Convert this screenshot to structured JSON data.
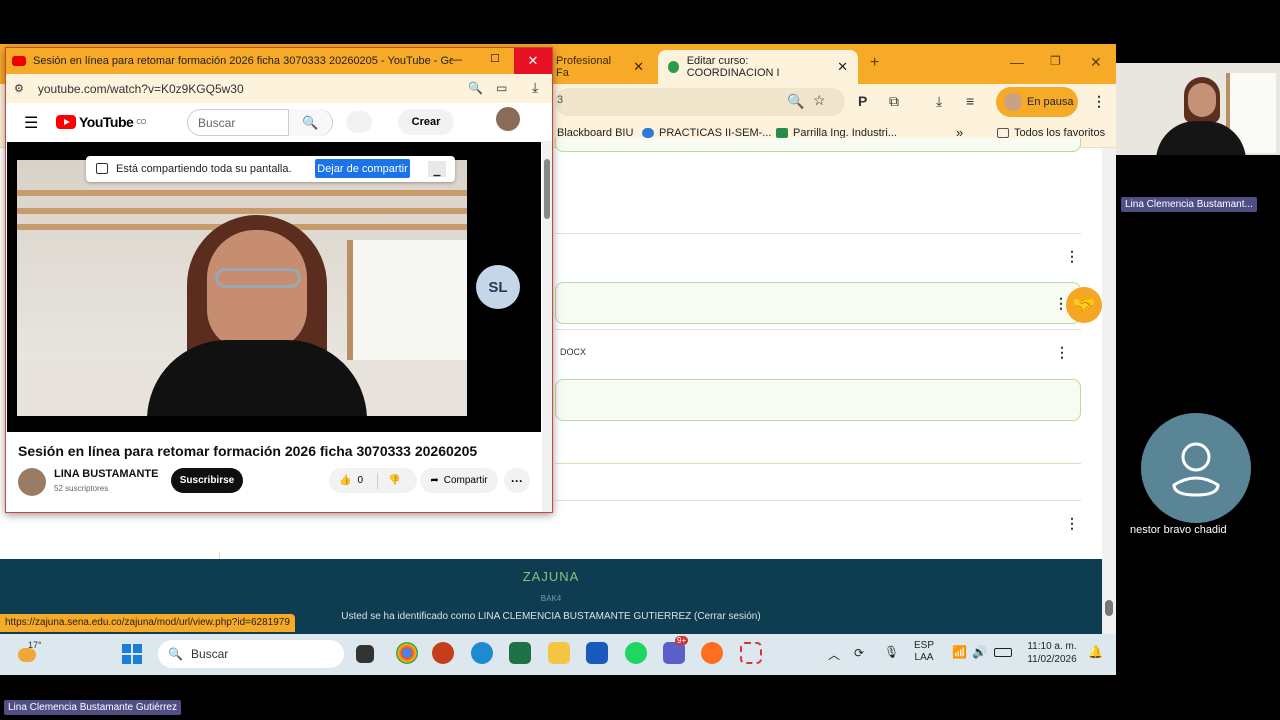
{
  "chrome": {
    "tab1_label": "Profesional Fa",
    "tab2_label": "Editar curso: COORDINACION I",
    "new_tab": "+",
    "pause_label": "En pausa",
    "bookmarks": [
      "Blackboard BIU",
      "PRACTICAS II-SEM-...",
      "Parrilla Ing. Industri...",
      "Todos los favoritos"
    ],
    "omnibox_fragment": "3",
    "hover_url": "https://zajuna.sena.edu.co/zajuna/mod/url/view.php?id=6281979"
  },
  "page": {
    "docx_label": "DOCX",
    "footer_logo": "ZAJUNA",
    "footer_sub": "BAK4",
    "footer_ident": "Usted se ha identificado como LINA CLEMENCIA BUSTAMANTE GUTIERREZ (Cerrar sesión)"
  },
  "youtube_window": {
    "title": "Sesión en línea para retomar formación 2026 ficha 3070333 20260205 - YouTube - Go...",
    "url": "youtube.com/watch?v=K0z9KGQ5w30",
    "brand": "YouTube",
    "brand_sup": "CO",
    "search_placeholder": "Buscar",
    "create_label": "Crear",
    "share_notice": "Está compartiendo toda su pantalla.",
    "stop_share_label": "Dejar de compartir",
    "video_avatar_initials": "SL",
    "video_title": "Sesión en línea para retomar formación 2026 ficha 3070333 20260205",
    "channel_name": "LINA BUSTAMANTE",
    "subscribers": "52 suscriptores",
    "subscribe_label": "Suscribirse",
    "like_count": "0",
    "share_label": "Compartir"
  },
  "taskbar": {
    "weather_temp": "17°",
    "search_label": "Buscar",
    "lang_top": "ESP",
    "lang_bottom": "LAA",
    "time": "11:10 a. m.",
    "date": "11/02/2026",
    "badge": "9+"
  },
  "meeting": {
    "presenter_label": "Lina Clemencia Bustamant...",
    "participant_name": "nestor bravo chadid",
    "bottom_label": "Lina Clemencia Bustamante Gutiérrez"
  }
}
